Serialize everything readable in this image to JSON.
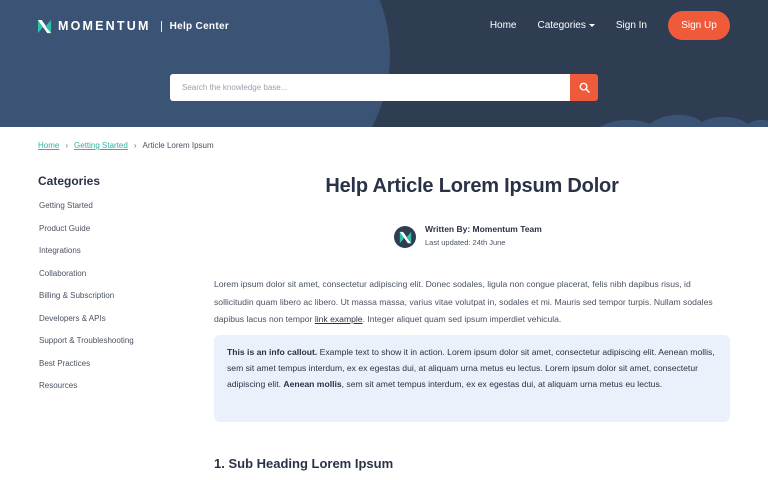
{
  "brand": {
    "name": "MOMENTUM",
    "section": "Help Center"
  },
  "nav": {
    "home": "Home",
    "categories": "Categories",
    "sign_in": "Sign In",
    "sign_up": "Sign Up"
  },
  "search": {
    "placeholder": "Search the knowledge base...",
    "value": ""
  },
  "breadcrumb": {
    "home": "Home",
    "section": "Getting Started",
    "current": "Article Lorem Ipsum"
  },
  "sidebar": {
    "title": "Categories",
    "items": [
      {
        "label": "Getting Started"
      },
      {
        "label": "Product Guide"
      },
      {
        "label": "Integrations"
      },
      {
        "label": "Collaboration"
      },
      {
        "label": "Billing & Subscription"
      },
      {
        "label": "Developers & APIs"
      },
      {
        "label": "Support & Troubleshooting"
      },
      {
        "label": "Best Practices"
      },
      {
        "label": "Resources"
      }
    ]
  },
  "article": {
    "title": "Help Article Lorem Ipsum Dolor",
    "author": "Written By: Momentum Team",
    "updated": "Last updated: 24th June",
    "intro_before_link": "Lorem ipsum dolor sit amet, consectetur adipiscing elit. Donec sodales, ligula non congue placerat, felis nibh dapibus risus, id sollicitudin quam libero ac libero. Ut massa massa, varius vitae volutpat in, sodales et mi. Mauris sed tempor turpis. Nullam sodales dapibus lacus non tempor ",
    "intro_link": "link example",
    "intro_after_link": ". Integer aliquet quam sed ipsum imperdiet vehicula.",
    "callout": {
      "bold_lead": "This is an info callout.",
      "text_1": " Example text to show it in action. Lorem ipsum dolor sit amet, consectetur adipiscing elit. Aenean mollis, sem sit amet tempus interdum, ex ex egestas dui, at aliquam urna metus eu lectus. Lorem ipsum dolor sit amet, consectetur adipiscing elit. ",
      "bold_mid": "Aenean mollis",
      "text_2": ", sem sit amet tempus interdum, ex ex egestas dui, at aliquam urna metus eu lectus."
    },
    "subheading": "1. Sub Heading Lorem Ipsum"
  },
  "colors": {
    "header_bg": "#2e3d52",
    "header_blob": "#3b5374",
    "accent": "#ef5b3a",
    "link": "#2fb3a2",
    "callout_bg": "#eaf1fb",
    "text": "#2a3346"
  },
  "icons": {
    "logo": "momentum-logo-icon",
    "search": "search-icon",
    "caret": "chevron-down-icon",
    "avatar": "momentum-avatar-icon"
  }
}
